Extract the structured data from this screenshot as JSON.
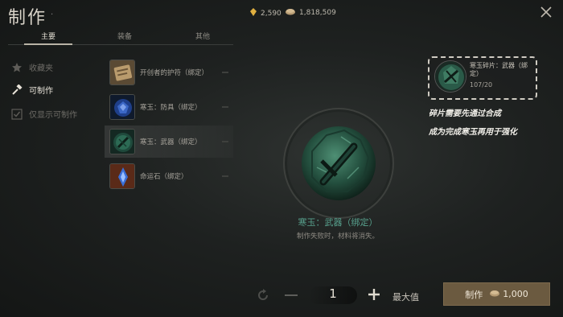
{
  "header": {
    "title": "制作",
    "dot": ".",
    "gold": "2,590",
    "silver": "1,818,509"
  },
  "tabs": [
    {
      "label": "主要"
    },
    {
      "label": "装备"
    },
    {
      "label": "其他"
    }
  ],
  "sidebar": {
    "items": [
      {
        "label": "收藏夹"
      },
      {
        "label": "可制作"
      },
      {
        "label": "仅显示可制作"
      }
    ]
  },
  "recipes": [
    {
      "label": "开创者的护符（绑定）"
    },
    {
      "label": "寒玉：防具（绑定）"
    },
    {
      "label": "寒玉：武器（绑定）"
    },
    {
      "label": "命运石（绑定）"
    }
  ],
  "detail": {
    "name": "寒玉：武器（绑定）",
    "description": "制作失败时，材料将消失。"
  },
  "material": {
    "name": "寒玉碎片：武器（绑定）",
    "count": "107/20"
  },
  "note": {
    "line1": "碎片需要先通过合成",
    "line2": "成为完成寒玉再用于强化"
  },
  "controls": {
    "quantity": "1",
    "max_label": "最大值",
    "craft_label": "制作",
    "craft_cost": "1,000"
  },
  "colors": {
    "accent_green": "#57a08c",
    "craft_button": "#6b5a40"
  }
}
